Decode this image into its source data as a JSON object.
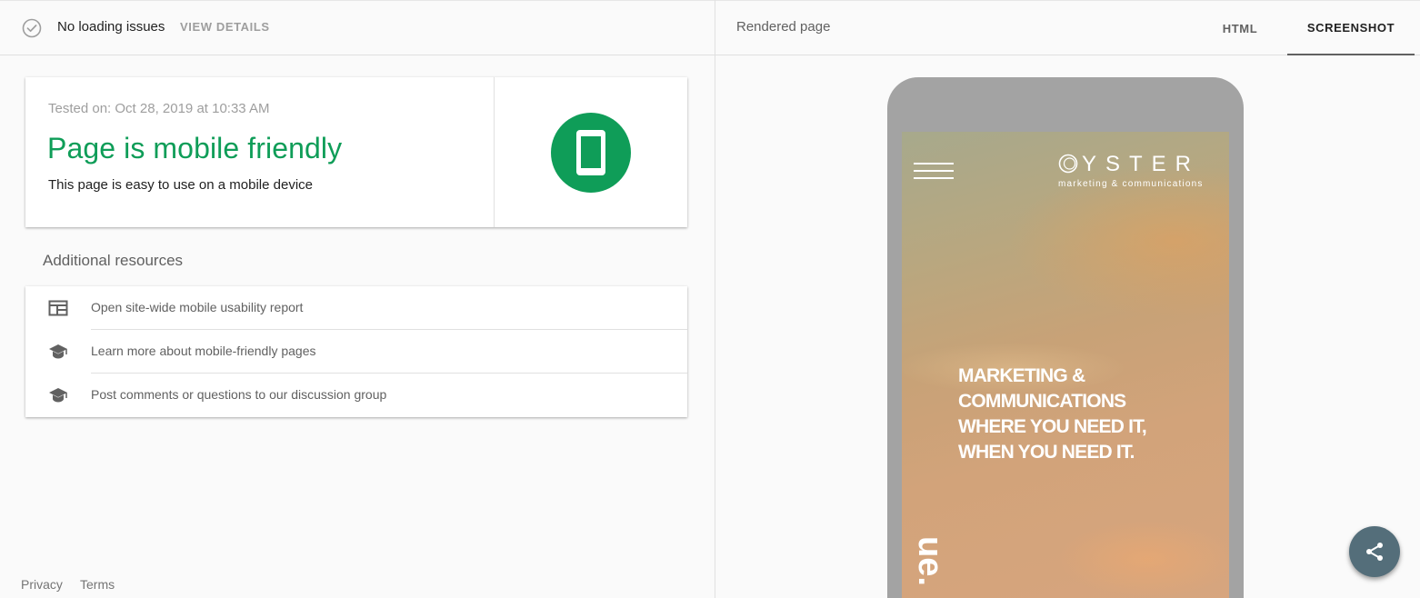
{
  "status_bar": {
    "status_text": "No loading issues",
    "view_details": "VIEW DETAILS"
  },
  "result": {
    "tested_on": "Tested on: Oct 28, 2019 at 10:33 AM",
    "verdict": "Page is mobile friendly",
    "description": "This page is easy to use on a mobile device",
    "verdict_color": "#0f9d58"
  },
  "additional_resources": {
    "title": "Additional resources",
    "items": [
      {
        "label": "Open site-wide mobile usability report",
        "icon": "report-icon"
      },
      {
        "label": "Learn more about mobile-friendly pages",
        "icon": "school-icon"
      },
      {
        "label": "Post comments or questions to our discussion group",
        "icon": "school-icon"
      }
    ]
  },
  "footer": {
    "privacy": "Privacy",
    "terms": "Terms"
  },
  "rendered_panel": {
    "title": "Rendered page",
    "tabs": [
      {
        "label": "HTML",
        "active": false
      },
      {
        "label": "SCREENSHOT",
        "active": true
      }
    ]
  },
  "screenshot": {
    "logo_word": "YSTER",
    "logo_sub": "marketing & communications",
    "hero_lines": [
      "MARKETING &",
      "COMMUNICATIONS",
      "WHERE YOU NEED IT,",
      "WHEN YOU NEED IT."
    ],
    "vertical_word": "ue."
  },
  "fab": {
    "icon": "share-icon"
  }
}
